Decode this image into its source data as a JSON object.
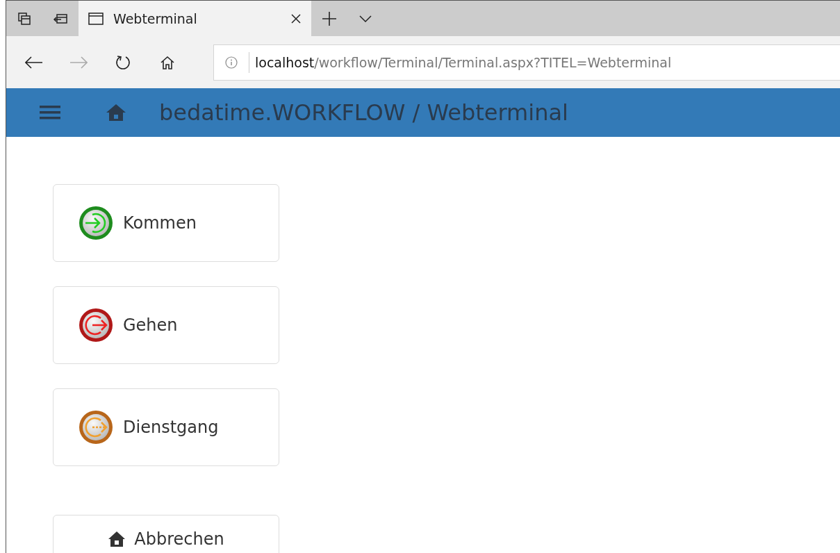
{
  "browser": {
    "tab": {
      "title": "Webterminal",
      "selected": true
    },
    "address": {
      "host": "localhost",
      "path": "/workflow/Terminal/Terminal.aspx?TITEL=Webterminal"
    }
  },
  "header": {
    "title": "bedatime.WORKFLOW / Webterminal"
  },
  "actions": [
    {
      "kind": "in",
      "label": "Kommen"
    },
    {
      "kind": "out",
      "label": "Gehen"
    },
    {
      "kind": "errand",
      "label": "Dienstgang"
    }
  ],
  "cancel": {
    "kind": "home",
    "label": "Abbrechen"
  }
}
